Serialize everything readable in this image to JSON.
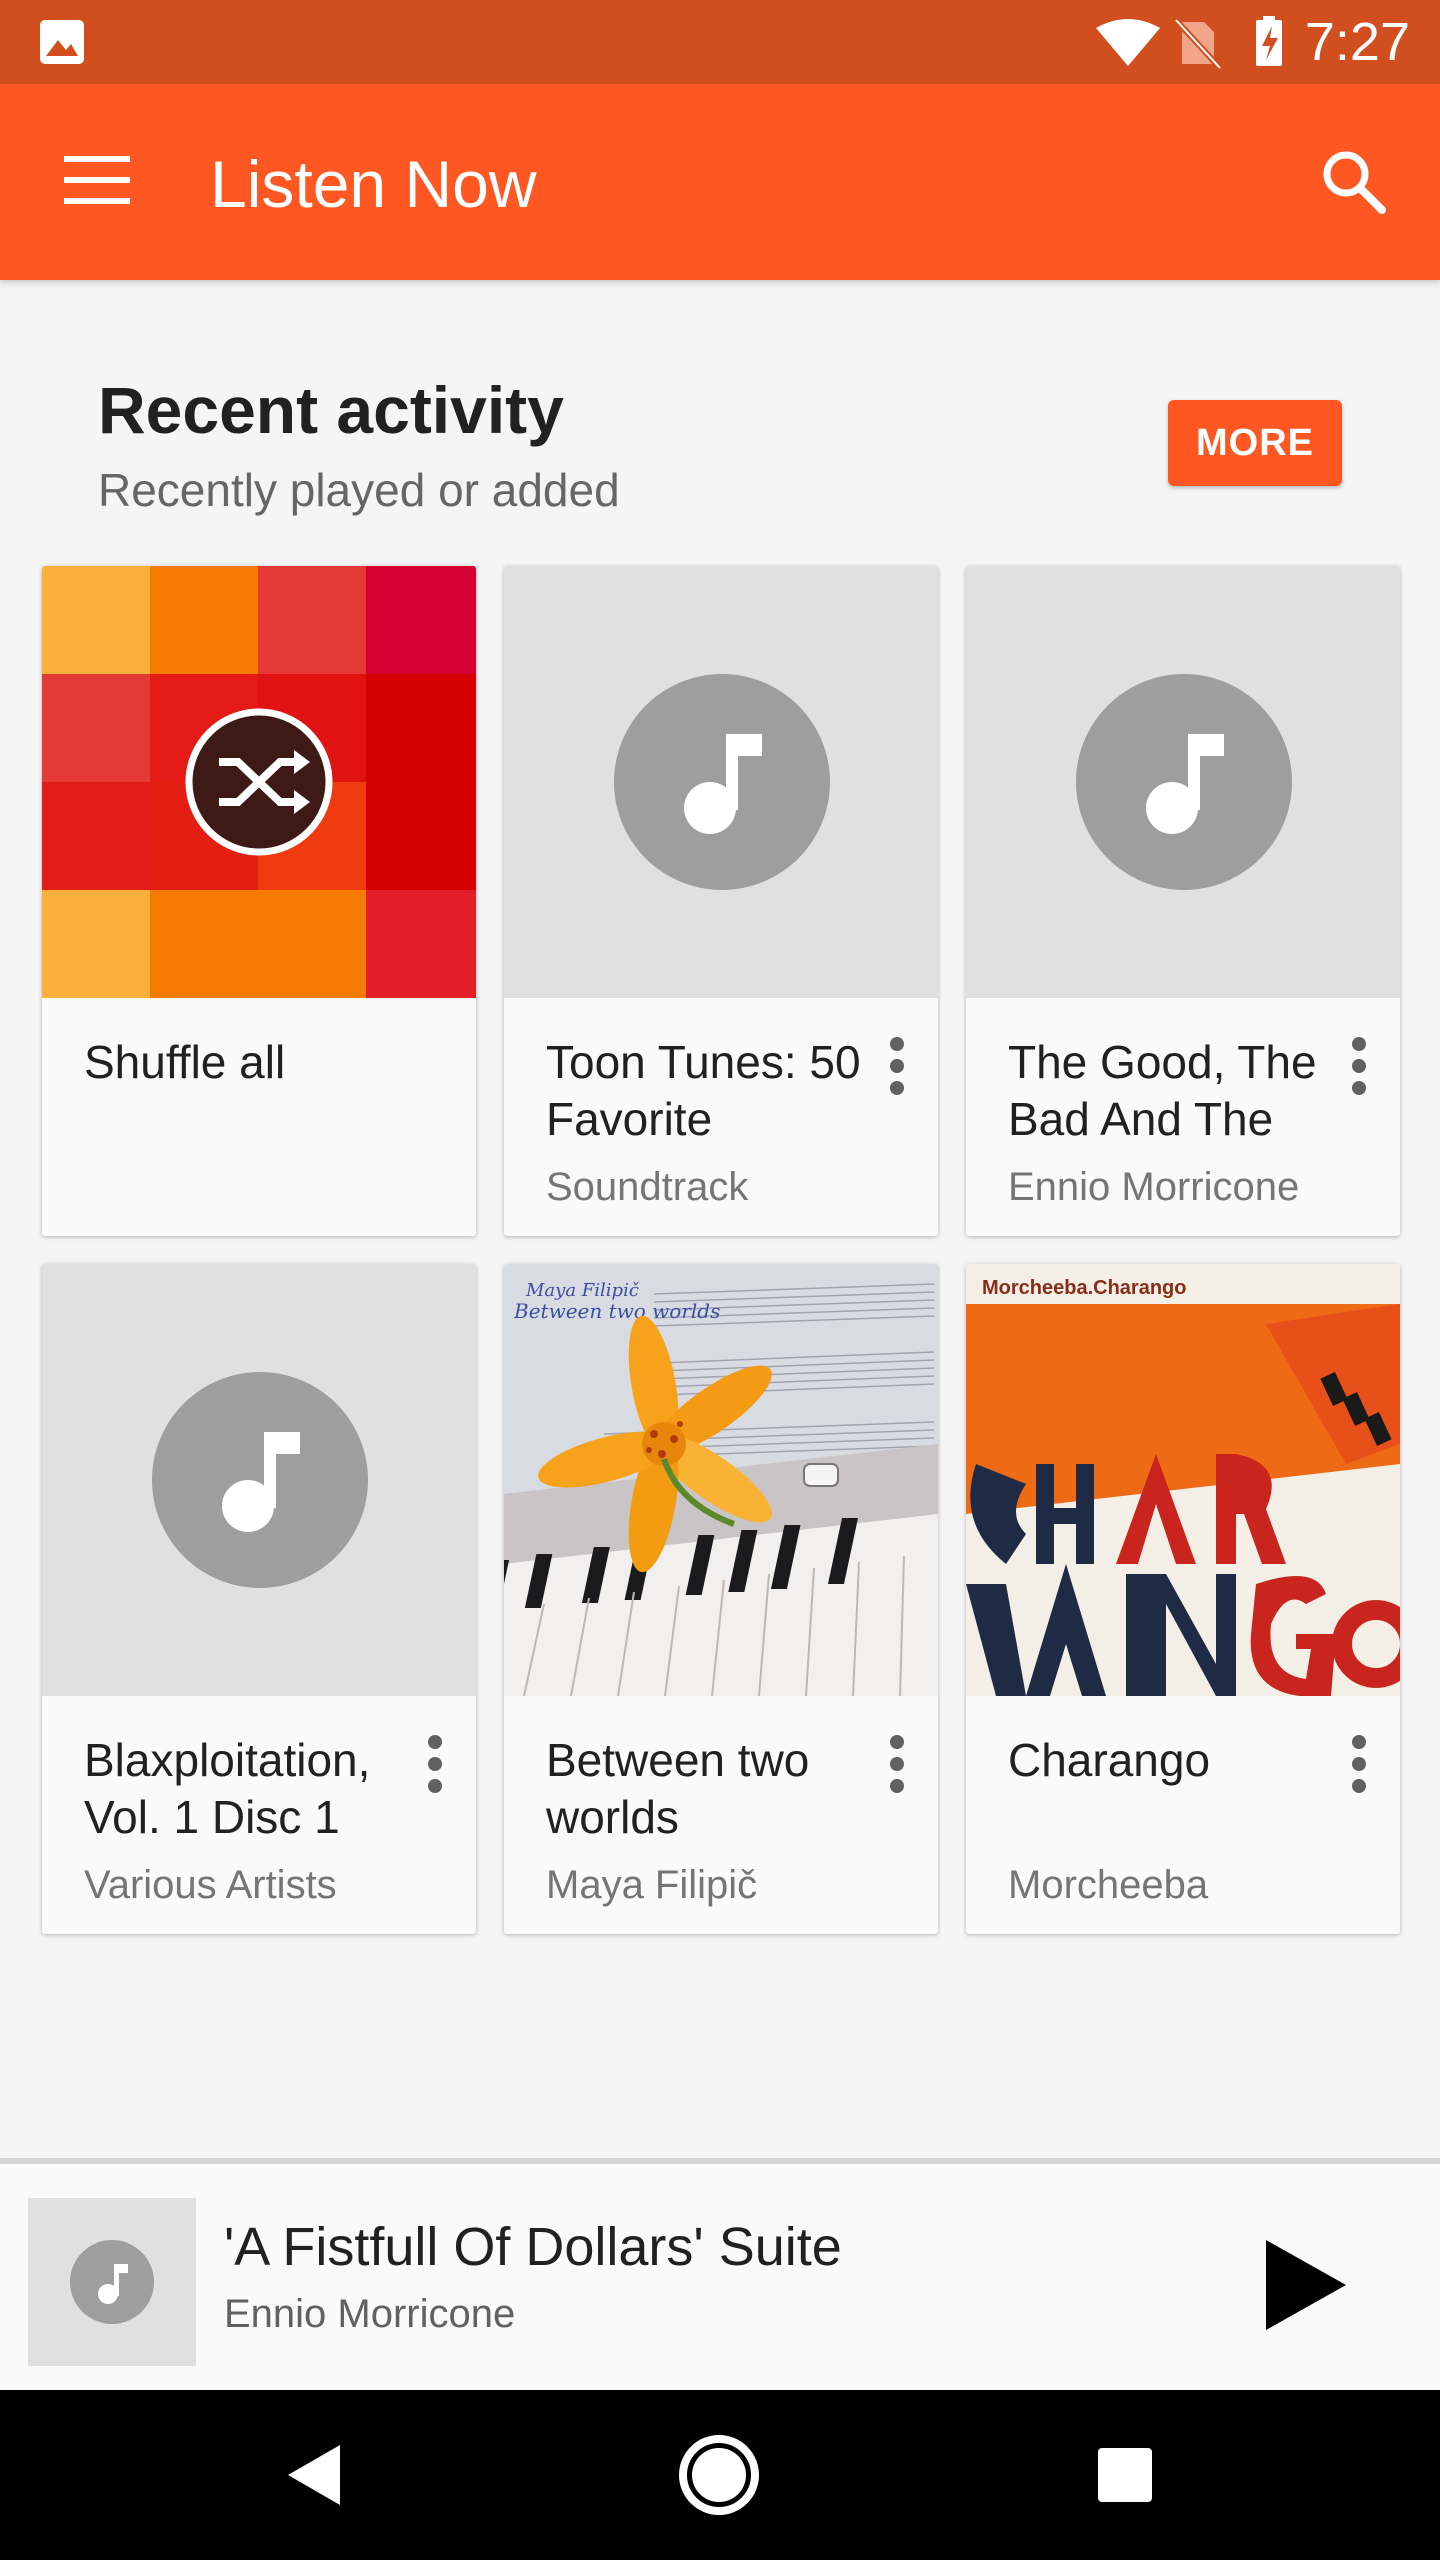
{
  "status_bar": {
    "time": "7:27"
  },
  "app_bar": {
    "title": "Listen Now"
  },
  "section": {
    "title": "Recent activity",
    "subtitle": "Recently played or added",
    "more_label": "MORE"
  },
  "cards": [
    {
      "title": "Shuffle all",
      "subtitle": ""
    },
    {
      "title": "Toon Tunes: 50 Favorite",
      "subtitle": "Soundtrack"
    },
    {
      "title": "The Good, The Bad And The",
      "subtitle": "Ennio Morricone"
    },
    {
      "title": "Blaxploitation, Vol. 1 Disc 1",
      "subtitle": "Various Artists"
    },
    {
      "title": "Between two worlds",
      "subtitle": "Maya Filipič",
      "art_text": [
        "Maya Filipič",
        "Between two worlds"
      ]
    },
    {
      "title": "Charango",
      "subtitle": "Morcheeba",
      "art_text": [
        "Morcheeba.Charango"
      ]
    }
  ],
  "now_playing": {
    "title": "'A Fistfull Of Dollars' Suite",
    "artist": "Ennio Morricone"
  },
  "colors": {
    "status_bar": "#d14e1f",
    "app_bar": "#ff5722",
    "accent": "#ff5722",
    "background": "#f5f5f5"
  }
}
